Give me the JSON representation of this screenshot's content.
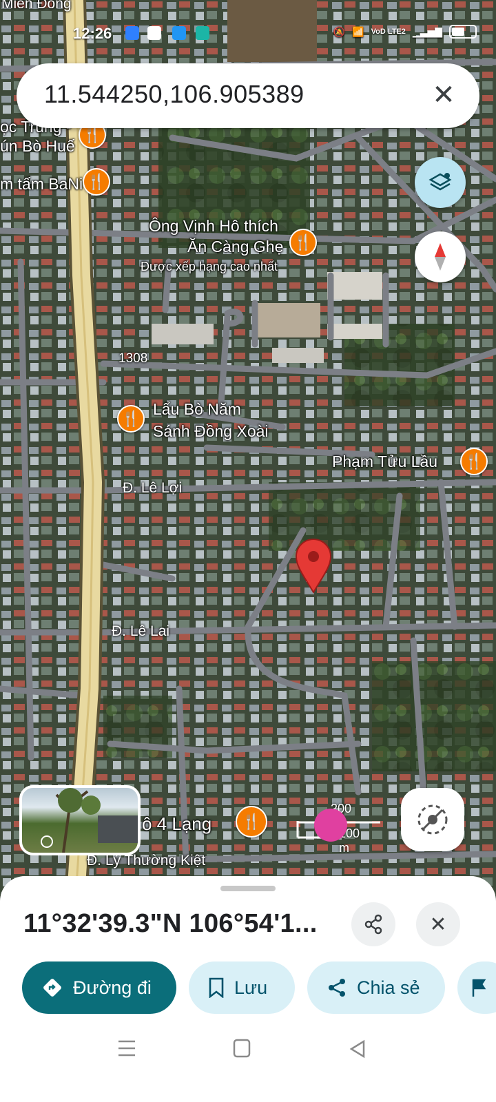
{
  "status_bar": {
    "time": "12:26",
    "network": "VoD LTE2"
  },
  "search": {
    "query": "11.544250,106.905389"
  },
  "map": {
    "pois": [
      {
        "name": "Ông Vịnh Hô thích Ăn Càng Ghẹ",
        "line1": "Ông Vịnh Hô thích",
        "line2": "Ăn Càng Ghẹ",
        "note": "Được xếp hạng cao nhất"
      },
      {
        "name": "Lẩu Bò Năm Sánh Đồng Xoài",
        "line1": "Lẩu Bò Năm",
        "line2": "Sánh Đồng Xoài"
      },
      {
        "name": "Phạm Tửu Lầu"
      },
      {
        "name": "m tấm BaNi"
      },
      {
        "name": "ọc Trung - bún Bò Huế",
        "line1": "ọc Trung -",
        "line2": "ún Bò Huế"
      },
      {
        "name": "ô 4 Lạng"
      }
    ],
    "roads": [
      "Miền Đông",
      "1308",
      "Đ. Lê Lợi",
      "Đ. Lê Lai",
      "Đ. Lý Thường Kiệt"
    ],
    "scale": {
      "feet": "200 bộ",
      "meters": "100 m"
    }
  },
  "sheet": {
    "coordinates": "11°32'39.3\"N 106°54'1...",
    "buttons": {
      "directions": "Đường đi",
      "save": "Lưu",
      "share": "Chia sẻ"
    }
  },
  "colors": {
    "primary": "#0b6e7a",
    "chip_bg": "#d9f0f7",
    "pin": "#e53935",
    "poi": "#f57c00"
  }
}
